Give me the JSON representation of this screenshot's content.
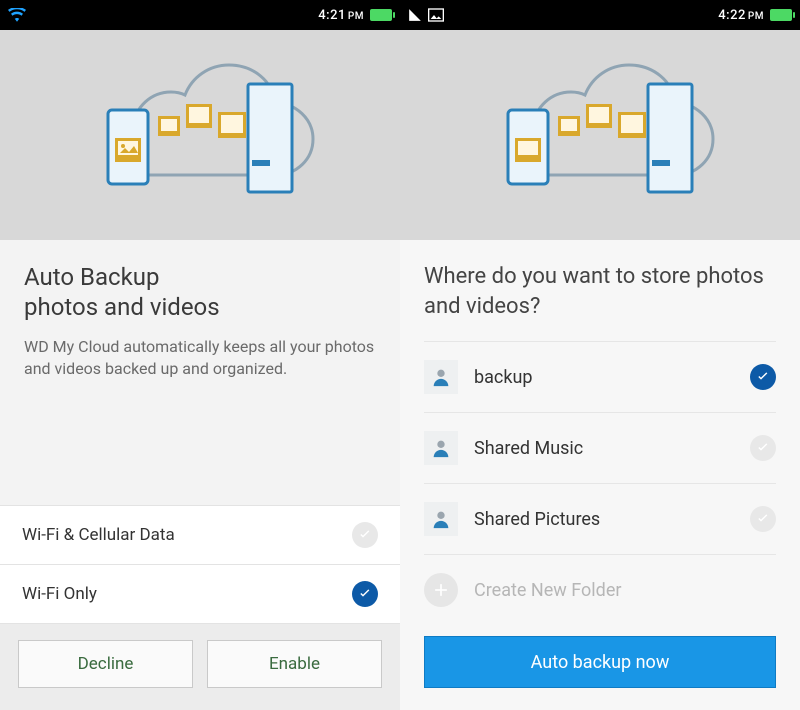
{
  "screens": [
    {
      "status": {
        "time": "4:21",
        "ampm": "PM"
      },
      "title": "Auto Backup\nphotos and videos",
      "desc": "WD My Cloud automatically keeps all your photos and videos backed up and organized.",
      "options": [
        {
          "label": "Wi-Fi & Cellular Data",
          "selected": false
        },
        {
          "label": "Wi-Fi Only",
          "selected": true
        }
      ],
      "buttons": {
        "decline": "Decline",
        "enable": "Enable"
      }
    },
    {
      "status": {
        "time": "4:22",
        "ampm": "PM"
      },
      "question": "Where do you want to store photos and videos?",
      "folders": [
        {
          "label": "backup",
          "selected": true
        },
        {
          "label": "Shared Music",
          "selected": false
        },
        {
          "label": "Shared Pictures",
          "selected": false
        }
      ],
      "create_label": "Create New Folder",
      "cta": "Auto backup now"
    }
  ]
}
